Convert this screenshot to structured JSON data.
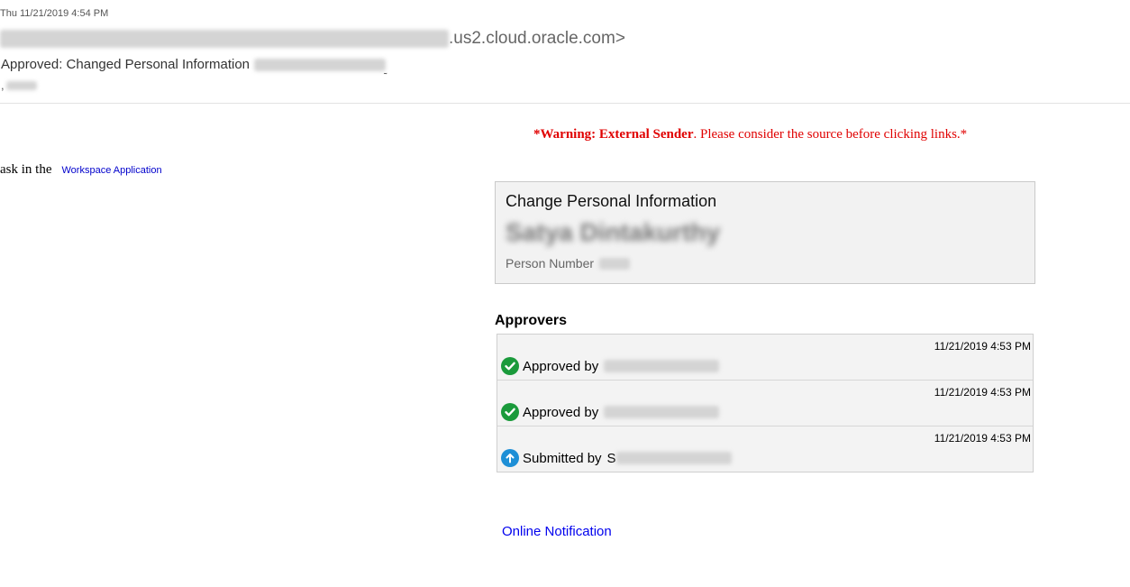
{
  "email": {
    "date": "Thu 11/21/2019 4:54 PM",
    "sender_domain": ".us2.cloud.oracle.com>",
    "subject": "Approved: Changed Personal Information",
    "to_prefix": ","
  },
  "banner": {
    "warning_bold": "*Warning: External Sender",
    "warning_rest": ". Please consider the source before clicking links.*"
  },
  "body": {
    "task_text": "ask in the",
    "workspace_link": "Workspace Application"
  },
  "card": {
    "title": "Change Personal Information",
    "name": "Satya Dintakurthy",
    "person_number_label": "Person Number"
  },
  "approvers": {
    "title": "Approvers",
    "rows": [
      {
        "time": "11/21/2019 4:53 PM",
        "action": "Approved by",
        "icon": "check-icon"
      },
      {
        "time": "11/21/2019 4:53 PM",
        "action": "Approved by",
        "icon": "check-icon"
      },
      {
        "time": "11/21/2019 4:53 PM",
        "action": "Submitted by",
        "prefix": "S",
        "icon": "submit-up-icon"
      }
    ]
  },
  "footer": {
    "online_link": "Online Notification"
  },
  "colors": {
    "warning": "#e00000",
    "link": "#0000ee",
    "approved_icon": "#1a9a3b",
    "submitted_icon": "#1e8fd6"
  }
}
